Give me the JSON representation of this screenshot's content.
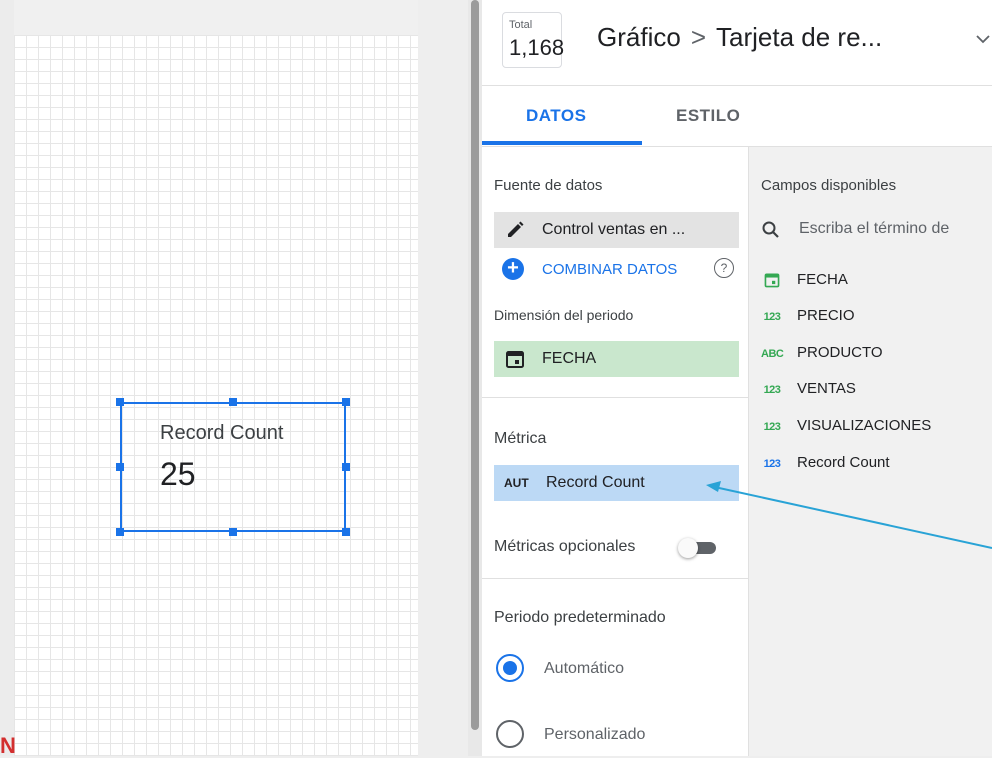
{
  "canvas": {
    "widget": {
      "label": "Record Count",
      "value": "25"
    }
  },
  "header": {
    "total_label": "Total",
    "total_value": "1,168",
    "breadcrumb_root": "Gráfico",
    "breadcrumb_sep": ">",
    "breadcrumb_current": "Tarjeta de re..."
  },
  "tabs": [
    {
      "label": "DATOS",
      "active": true
    },
    {
      "label": "ESTILO",
      "active": false
    }
  ],
  "data": {
    "source_heading": "Fuente de datos",
    "source_value": "Control ventas en ...",
    "combine_label": "COMBINAR DATOS",
    "help_icon": "?",
    "period_dimension_heading": "Dimensión del periodo",
    "period_dimension_value": "FECHA",
    "metric_heading": "Métrica",
    "metric_aggregation": "AUT",
    "metric_value": "Record Count",
    "optional_metrics_label": "Métricas opcionales",
    "default_period_heading": "Periodo predeterminado",
    "period_options": [
      {
        "label": "Automático",
        "selected": true
      },
      {
        "label": "Personalizado",
        "selected": false
      }
    ]
  },
  "fields": {
    "heading": "Campos disponibles",
    "search_placeholder": "Escriba el término de",
    "items": [
      {
        "type": "date",
        "name": "FECHA"
      },
      {
        "type": "123",
        "name": "PRECIO"
      },
      {
        "type": "ABC",
        "name": "PRODUCTO"
      },
      {
        "type": "123",
        "name": "VENTAS"
      },
      {
        "type": "123",
        "name": "VISUALIZACIONES"
      },
      {
        "type": "123",
        "name": "Record Count"
      }
    ]
  },
  "colors": {
    "accent": "#1a73e8",
    "dimension_chip": "#c9e7cd",
    "metric_chip": "#bcd9f5",
    "annotation_arrow": "#29a3d6"
  }
}
